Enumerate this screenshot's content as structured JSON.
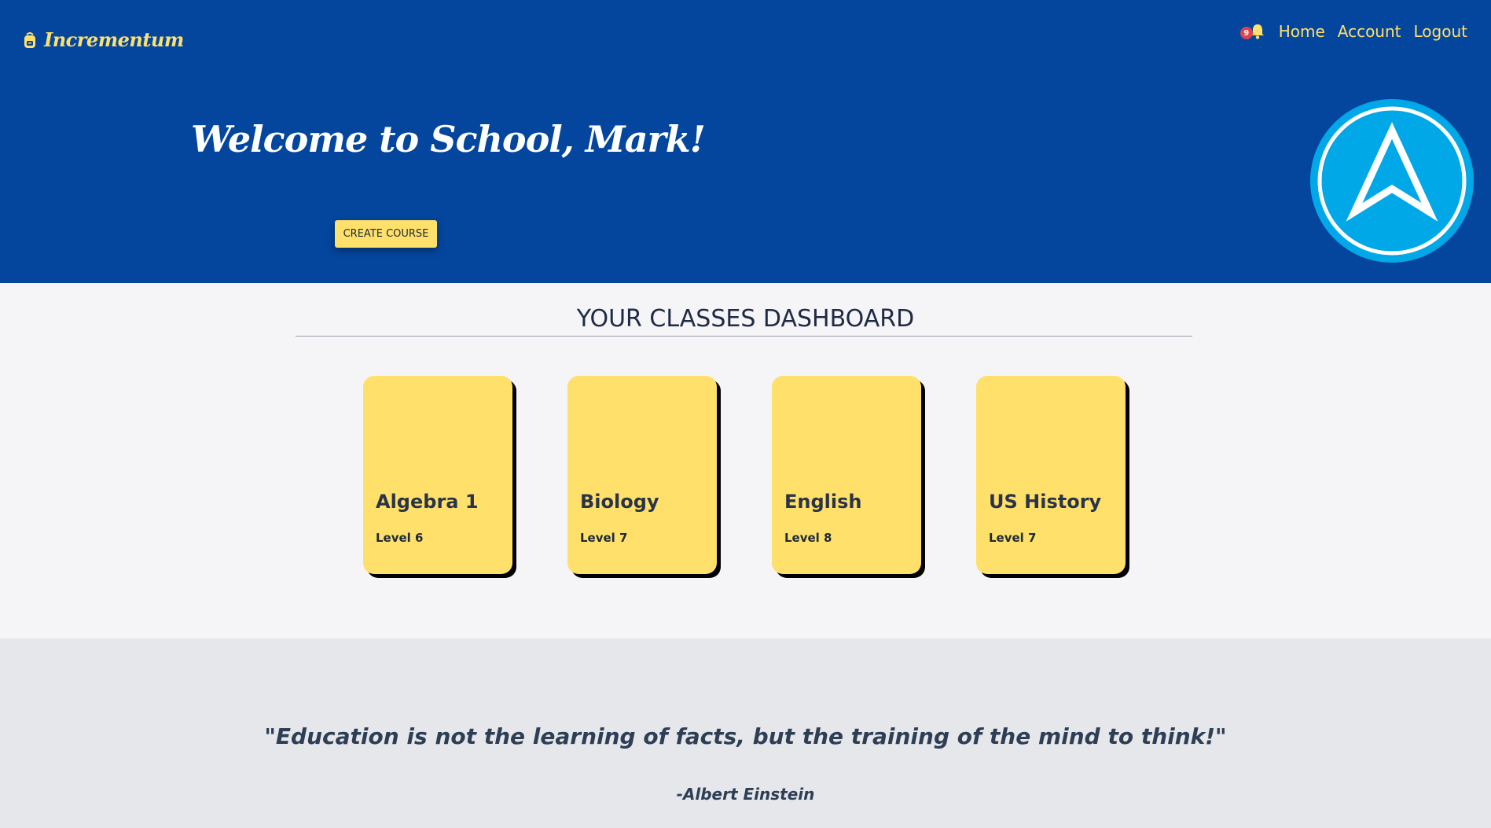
{
  "brand": {
    "name": "Incrementum",
    "icon": "backpack-icon"
  },
  "nav": {
    "notification_count": "9",
    "notification_icon": "bell-icon",
    "links": [
      "Home",
      "Account",
      "Logout"
    ]
  },
  "hero": {
    "welcome": "Welcome to School, Mark!",
    "create_button": "CREATE COURSE",
    "badge_icon": "arrow-up-logo-icon"
  },
  "dashboard": {
    "title": "YOUR CLASSES DASHBOARD",
    "classes": [
      {
        "name": "Algebra 1",
        "level": "Level 6"
      },
      {
        "name": "Biology",
        "level": "Level 7"
      },
      {
        "name": "English",
        "level": "Level 8"
      },
      {
        "name": "US History",
        "level": "Level 7"
      }
    ]
  },
  "quote": {
    "text": "\"Education is not the learning of facts, but the training of the mind to think!\"",
    "author": "-Albert Einstein"
  },
  "colors": {
    "header_blue": "#04469e",
    "accent_yellow": "#ffe06a",
    "badge_red": "#e63e4a",
    "logo_cyan": "#00a8e8"
  }
}
